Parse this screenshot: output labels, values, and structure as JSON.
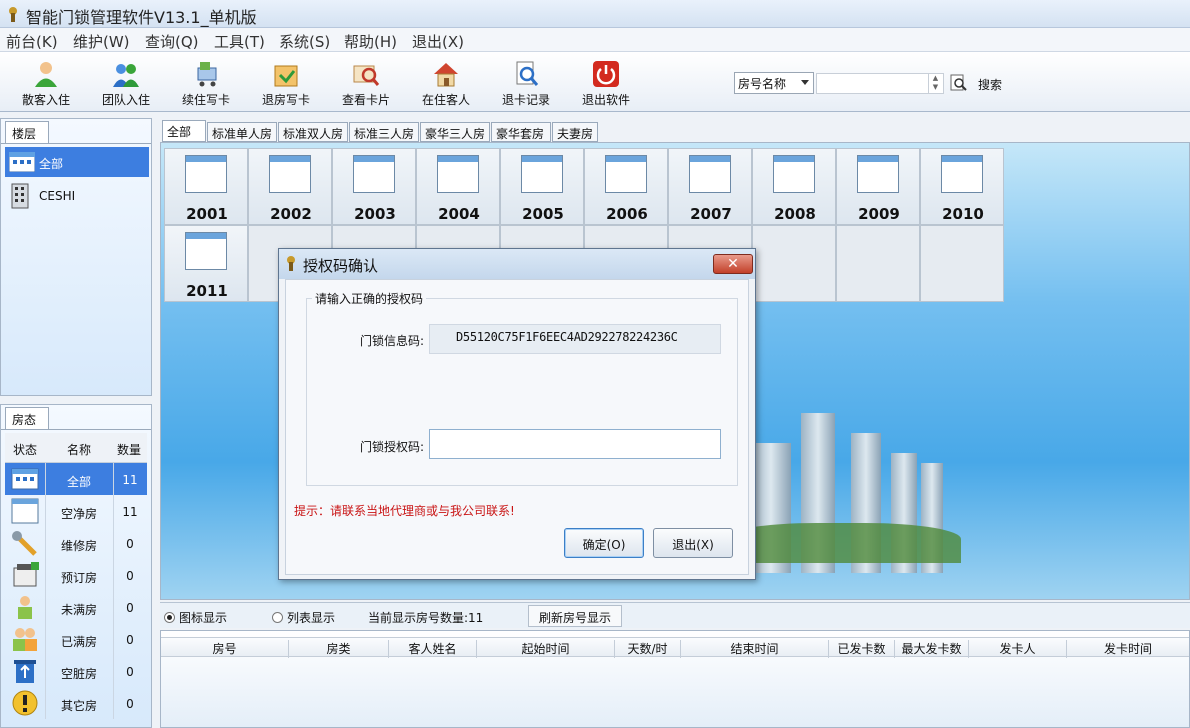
{
  "window": {
    "title": "智能门锁管理软件V13.1_单机版"
  },
  "menu": [
    "前台(K)",
    "维护(W)",
    "查询(Q)",
    "工具(T)",
    "系统(S)",
    "帮助(H)",
    "退出(X)"
  ],
  "toolbar": {
    "buttons": [
      {
        "label": "散客入住",
        "icon": "person-icon"
      },
      {
        "label": "团队入住",
        "icon": "group-icon"
      },
      {
        "label": "续住写卡",
        "icon": "cart-icon"
      },
      {
        "label": "退房写卡",
        "icon": "checkout-icon"
      },
      {
        "label": "查看卡片",
        "icon": "card-view-icon"
      },
      {
        "label": "在住客人",
        "icon": "house-icon"
      },
      {
        "label": "退卡记录",
        "icon": "record-icon"
      },
      {
        "label": "退出软件",
        "icon": "power-icon"
      }
    ],
    "search": {
      "field": "房号名称",
      "value": "",
      "button_label": "搜索"
    }
  },
  "floor_panel": {
    "tab": "楼层",
    "items": [
      "全部",
      "CESHI"
    ]
  },
  "status_panel": {
    "tab": "房态",
    "headers": [
      "状态",
      "名称",
      "数量"
    ],
    "rows": [
      {
        "name": "全部",
        "count": "11"
      },
      {
        "name": "空净房",
        "count": "11"
      },
      {
        "name": "维修房",
        "count": "0"
      },
      {
        "name": "预订房",
        "count": "0"
      },
      {
        "name": "未满房",
        "count": "0"
      },
      {
        "name": "已满房",
        "count": "0"
      },
      {
        "name": "空脏房",
        "count": "0"
      },
      {
        "name": "其它房",
        "count": "0"
      }
    ]
  },
  "room_tabs": [
    "全部",
    "标准单人房",
    "标准双人房",
    "标准三人房",
    "豪华三人房",
    "豪华套房",
    "夫妻房"
  ],
  "rooms": [
    "2001",
    "2002",
    "2003",
    "2004",
    "2005",
    "2006",
    "2007",
    "2008",
    "2009",
    "2010",
    "2011"
  ],
  "bottom": {
    "icon_view": "图标显示",
    "list_view": "列表显示",
    "room_count": "当前显示房号数量:11",
    "refresh": "刷新房号显示"
  },
  "grid_columns": [
    "房号",
    "房类",
    "客人姓名",
    "起始时间",
    "天数/时",
    "结束时间",
    "已发卡数",
    "最大发卡数",
    "发卡人",
    "发卡时间"
  ],
  "dialog": {
    "title": "授权码确认",
    "close": "✕",
    "group_label": "请输入正确的授权码",
    "lock_info_label": "门锁信息码:",
    "lock_info_value": "D55120C75F1F6EEC4AD292278224236C",
    "auth_code_label": "门锁授权码:",
    "auth_code_value": "",
    "hint": "提示：请联系当地代理商或与我公司联系!",
    "ok": "确定(O)",
    "exit": "退出(X)"
  }
}
